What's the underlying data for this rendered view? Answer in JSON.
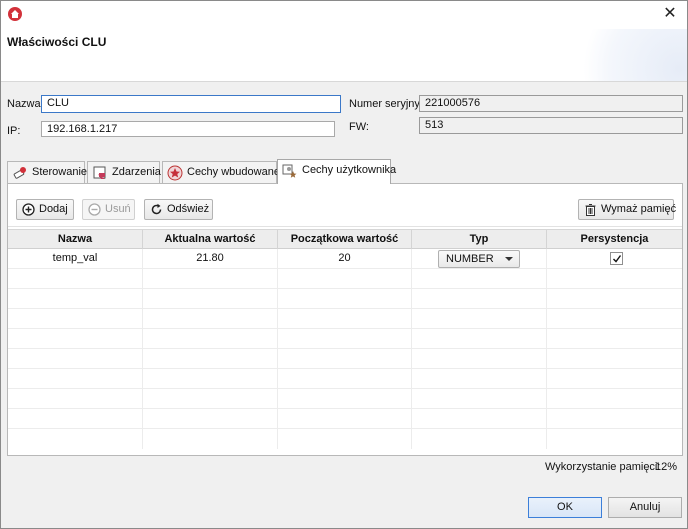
{
  "dialog": {
    "title": "Właściwości CLU",
    "close_glyph": "✕"
  },
  "form": {
    "name_label": "Nazwa:",
    "name_value": "CLU",
    "ip_label": "IP:",
    "ip_value": "192.168.1.217",
    "serial_label": "Numer seryjny:",
    "serial_value": "221000576",
    "fw_label": "FW:",
    "fw_value": "513"
  },
  "tabs": [
    {
      "label": "Sterowanie",
      "icon": "remote-control-icon"
    },
    {
      "label": "Zdarzenia",
      "icon": "events-icon"
    },
    {
      "label": "Cechy wbudowane",
      "icon": "star-badge-icon"
    },
    {
      "label": "Cechy użytkownika",
      "icon": "user-features-icon",
      "active": true
    }
  ],
  "toolbar": {
    "add_label": "Dodaj",
    "remove_label": "Usuń",
    "refresh_label": "Odśwież",
    "clear_memory_label": "Wymaż pamięć"
  },
  "table": {
    "columns": [
      "Nazwa",
      "Aktualna wartość",
      "Początkowa wartość",
      "Typ",
      "Persystencja"
    ],
    "rows": [
      {
        "name": "temp_val",
        "current": "21.80",
        "initial": "20",
        "type": "NUMBER",
        "persistent": true
      }
    ]
  },
  "memory": {
    "label": "Wykorzystanie pamięci:",
    "value": "12%"
  },
  "buttons": {
    "ok": "OK",
    "cancel": "Anuluj"
  },
  "colors": {
    "accent": "#3c7fd9",
    "app_icon": "#d2313a"
  }
}
